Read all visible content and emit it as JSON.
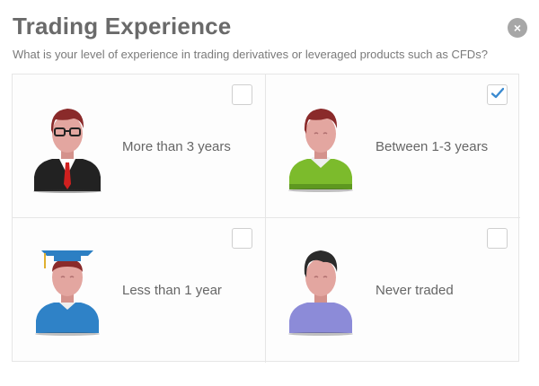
{
  "dialog": {
    "title": "Trading Experience",
    "subtitle": "What is your level of experience in trading derivatives or leveraged products such as CFDs?",
    "close_label": "×"
  },
  "options": [
    {
      "label": "More than 3 years",
      "checked": false,
      "avatar": "businessman-avatar"
    },
    {
      "label": "Between 1-3 years",
      "checked": true,
      "avatar": "casual-man-avatar"
    },
    {
      "label": "Less than 1 year",
      "checked": false,
      "avatar": "graduate-avatar"
    },
    {
      "label": "Never traded",
      "checked": false,
      "avatar": "beginner-avatar"
    }
  ],
  "colors": {
    "check": "#3a8ad0",
    "skin": "#e3a6a0",
    "hair_red": "#8a2a2a",
    "hair_dark": "#2b2b2b",
    "suit": "#222222",
    "tie": "#d0201f",
    "green_shirt": "#7cbb2c",
    "blue_shirt": "#2f82c7",
    "purple_shirt": "#8c8bd8",
    "cap": "#2c7fc3"
  }
}
